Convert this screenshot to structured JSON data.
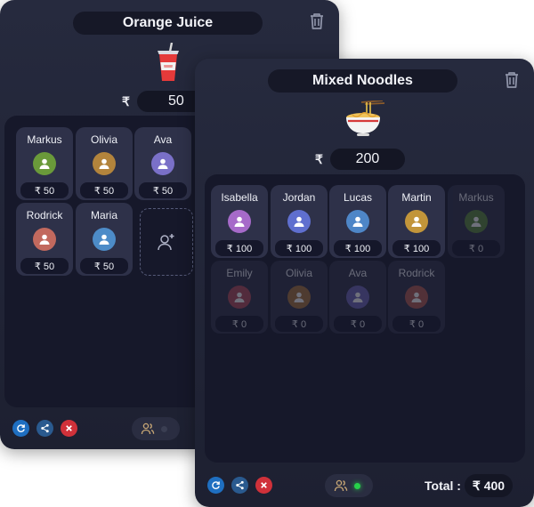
{
  "cards": [
    {
      "title": "Orange Juice",
      "currency": "₹",
      "price": "50",
      "participants": [
        {
          "name": "Markus",
          "amount": "₹ 50",
          "color": "#6a9a3a"
        },
        {
          "name": "Olivia",
          "amount": "₹ 50",
          "color": "#b3843c"
        },
        {
          "name": "Ava",
          "amount": "₹ 50",
          "color": "#7a70c8"
        },
        {
          "name": "Rodrick",
          "amount": "₹ 50",
          "color": "#c2695e"
        },
        {
          "name": "Maria",
          "amount": "₹ 50",
          "color": "#4d8cc8"
        }
      ],
      "icons": {
        "trash": "trash-icon",
        "food": "drink-cup-icon",
        "add": "add-person-icon",
        "refresh": "refresh-icon",
        "share": "share-icon",
        "close": "close-icon",
        "people": "people-icon"
      },
      "toggle_on": false
    },
    {
      "title": "Mixed Noodles",
      "currency": "₹",
      "price": "200",
      "participants": [
        {
          "name": "Isabella",
          "amount": "₹ 100",
          "color": "#a66ac9",
          "active": true
        },
        {
          "name": "Jordan",
          "amount": "₹ 100",
          "color": "#5f6fcf",
          "active": true
        },
        {
          "name": "Lucas",
          "amount": "₹ 100",
          "color": "#4e86c7",
          "active": true
        },
        {
          "name": "Martin",
          "amount": "₹ 100",
          "color": "#c2953a",
          "active": true
        },
        {
          "name": "Markus",
          "amount": "₹ 0",
          "color": "#5a8a3a",
          "active": false
        },
        {
          "name": "Emily",
          "amount": "₹ 0",
          "color": "#b34a5a",
          "active": false
        },
        {
          "name": "Olivia",
          "amount": "₹ 0",
          "color": "#a9753a",
          "active": false
        },
        {
          "name": "Ava",
          "amount": "₹ 0",
          "color": "#6e64b8",
          "active": false
        },
        {
          "name": "Rodrick",
          "amount": "₹ 0",
          "color": "#b35a50",
          "active": false
        }
      ],
      "icons": {
        "trash": "trash-icon",
        "food": "noodle-bowl-icon",
        "refresh": "refresh-icon",
        "share": "share-icon",
        "close": "close-icon",
        "people": "people-icon"
      },
      "toggle_on": true,
      "total_label": "Total :",
      "total_value": "₹ 400"
    }
  ]
}
